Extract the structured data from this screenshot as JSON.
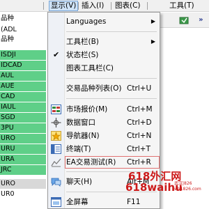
{
  "menubar": {
    "items": [
      {
        "label": "显示(V)"
      },
      {
        "label": "插入(I)"
      },
      {
        "label": "图表(C)"
      },
      {
        "label": "工具(T)"
      }
    ]
  },
  "left_panel": {
    "rows": [
      {
        "text": "品种"
      },
      {
        "text": "(ADL"
      },
      {
        "text": "品种"
      },
      {
        "text": "ISDJI"
      },
      {
        "text": "IDCAD"
      },
      {
        "text": "AUL"
      },
      {
        "text": "AUE"
      },
      {
        "text": "CAD"
      },
      {
        "text": "IAUL"
      },
      {
        "text": "SGD"
      },
      {
        "text": "3PU"
      },
      {
        "text": "URO"
      },
      {
        "text": "URU"
      },
      {
        "text": "URA"
      },
      {
        "text": "JRC"
      },
      {
        "text": "URO"
      },
      {
        "text": "UR0"
      }
    ]
  },
  "dropdown": {
    "items": [
      {
        "label": "Languages",
        "shortcut": "",
        "submenu": true,
        "icon": ""
      },
      {
        "label": "工具栏(B)",
        "shortcut": "",
        "submenu": true,
        "icon": ""
      },
      {
        "label": "状态栏(S)",
        "shortcut": "",
        "checked": true,
        "icon": "checkmark"
      },
      {
        "label": "图表工具栏(C)",
        "shortcut": "",
        "icon": ""
      },
      {
        "label": "交易品种列表(O)",
        "shortcut": "Ctrl+U",
        "icon": ""
      },
      {
        "label": "市场报价(M)",
        "shortcut": "Ctrl+M",
        "icon": "market-watch-icon"
      },
      {
        "label": "数据窗口",
        "shortcut": "Ctrl+D",
        "icon": "data-window-icon"
      },
      {
        "label": "导航器(N)",
        "shortcut": "Ctrl+N",
        "icon": "navigator-icon"
      },
      {
        "label": "终端(T)",
        "shortcut": "Ctrl+T",
        "icon": "terminal-icon"
      },
      {
        "label": "EA交易测试(R)",
        "shortcut": "Ctrl+R",
        "icon": "strategy-tester-icon"
      },
      {
        "label": "聊天(H)",
        "shortcut": "Alt+M",
        "icon": "chat-icon"
      },
      {
        "label": "全屏幕",
        "shortcut": "F11",
        "icon": "fullscreen-icon"
      }
    ]
  },
  "watermark": {
    "line1": "618外汇网",
    "line2": "618waihu",
    "line3a": "武汉|826",
    "line3b": "wh1826.com"
  },
  "colors": {
    "menu_active_bg": "#cfe3f7",
    "symbol_green": "#5fcf88",
    "highlight_border": "#e07070",
    "watermark_red": "#cc1a1a"
  }
}
